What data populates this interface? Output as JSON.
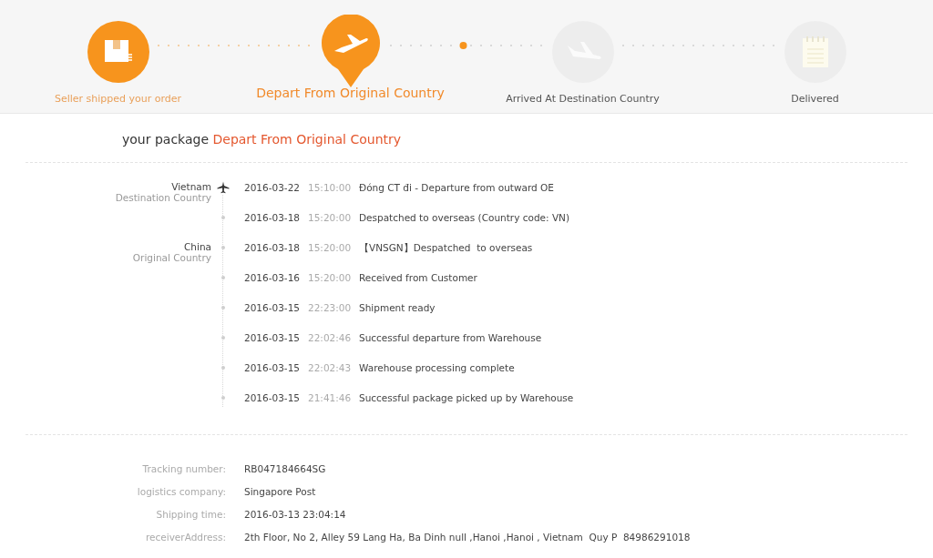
{
  "steps": [
    {
      "label": "Seller shipped your order",
      "done": true,
      "selected": false,
      "kind": "box"
    },
    {
      "label": "Depart From Original Country",
      "done": true,
      "selected": true,
      "kind": "plane-up"
    },
    {
      "label": "Arrived At Destination Country",
      "done": false,
      "selected": false,
      "kind": "plane-down"
    },
    {
      "label": "Delivered",
      "done": false,
      "selected": false,
      "kind": "notepad"
    }
  ],
  "status": {
    "prefix": "your package",
    "value": "Depart From Original Country"
  },
  "events": [
    {
      "kind": "plane",
      "location": "Vietnam",
      "location_type": "Destination Country",
      "date": "2016-03-22",
      "time": "15:10:00",
      "description": "Đóng CT đi - Departure from outward OE"
    },
    {
      "kind": "dot",
      "date": "2016-03-18",
      "time": "15:20:00",
      "description": "Despatched to overseas (Country code: VN)"
    },
    {
      "kind": "dot",
      "location": "China",
      "location_type": "Original Country",
      "date": "2016-03-18",
      "time": "15:20:00",
      "description": "【VNSGN】Despatched  to overseas"
    },
    {
      "kind": "dot",
      "date": "2016-03-16",
      "time": "15:20:00",
      "description": "Received from Customer"
    },
    {
      "kind": "dot",
      "date": "2016-03-15",
      "time": "22:23:00",
      "description": "Shipment ready"
    },
    {
      "kind": "dot",
      "date": "2016-03-15",
      "time": "22:02:46",
      "description": "Successful departure from Warehouse"
    },
    {
      "kind": "dot",
      "date": "2016-03-15",
      "time": "22:02:43",
      "description": "Warehouse processing complete"
    },
    {
      "kind": "dot",
      "date": "2016-03-15",
      "time": "21:41:46",
      "description": "Successful package picked up by Warehouse"
    }
  ],
  "details": [
    {
      "label": "Tracking number:",
      "value": "RB047184664SG"
    },
    {
      "label": "logistics company:",
      "value": "Singapore Post"
    },
    {
      "label": "Shipping time:",
      "value": "2016-03-13 23:04:14"
    },
    {
      "label": "receiverAddress:",
      "value": "2th Floor, No 2, Alley 59 Lang Ha, Ba Dinh null ,Hanoi ,Hanoi , Vietnam  Quy P  84986291018"
    }
  ]
}
